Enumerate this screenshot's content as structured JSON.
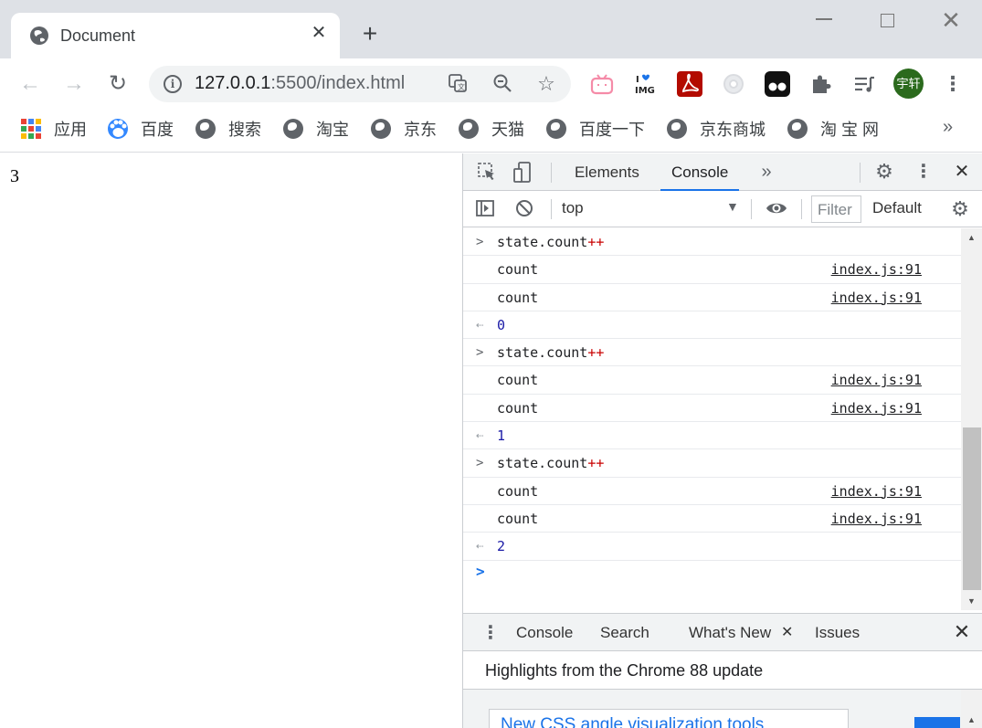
{
  "window": {
    "tab_title": "Document",
    "new_tab_icon": "plus-icon"
  },
  "toolbar": {
    "url_host": "127.0.0.1",
    "url_rest": ":5500/index.html",
    "avatar_text": "宇轩"
  },
  "bookmarks": {
    "items": [
      {
        "label": "应用",
        "icon": "apps-icon"
      },
      {
        "label": "百度",
        "icon": "baidu-icon"
      },
      {
        "label": "搜索",
        "icon": "globe-icon"
      },
      {
        "label": "淘宝",
        "icon": "globe-icon"
      },
      {
        "label": "京东",
        "icon": "globe-icon"
      },
      {
        "label": "天猫",
        "icon": "globe-icon"
      },
      {
        "label": "百度一下",
        "icon": "globe-icon"
      },
      {
        "label": "京东商城",
        "icon": "globe-icon"
      },
      {
        "label": "淘 宝 网",
        "icon": "globe-icon"
      }
    ],
    "more": "»"
  },
  "page": {
    "count_text": "3"
  },
  "devtools": {
    "tabs": [
      "Elements",
      "Console"
    ],
    "active_tab": "Console",
    "context": "top",
    "filter_placeholder": "Filter",
    "levels": "Default",
    "console": [
      {
        "kind": "input",
        "text": "state.count",
        "op": "++"
      },
      {
        "kind": "log",
        "text": "count",
        "source": "index.js:91"
      },
      {
        "kind": "log",
        "text": "count",
        "source": "index.js:91"
      },
      {
        "kind": "result",
        "text": "0"
      },
      {
        "kind": "input",
        "text": "state.count",
        "op": "++"
      },
      {
        "kind": "log",
        "text": "count",
        "source": "index.js:91"
      },
      {
        "kind": "log",
        "text": "count",
        "source": "index.js:91"
      },
      {
        "kind": "result",
        "text": "1"
      },
      {
        "kind": "input",
        "text": "state.count",
        "op": "++"
      },
      {
        "kind": "log",
        "text": "count",
        "source": "index.js:91"
      },
      {
        "kind": "log",
        "text": "count",
        "source": "index.js:91"
      },
      {
        "kind": "result",
        "text": "2"
      }
    ],
    "drawer": {
      "tabs": [
        "Console",
        "Search",
        "What's New",
        "Issues"
      ],
      "active_tab": "What's New",
      "whats_new_heading": "Highlights from the Chrome 88 update",
      "card_title": "New CSS angle visualization tools"
    }
  },
  "colors": {
    "accent": "#1a73e8",
    "tabstrip": "#dee1e6",
    "devtools_bar": "#f1f3f4"
  }
}
